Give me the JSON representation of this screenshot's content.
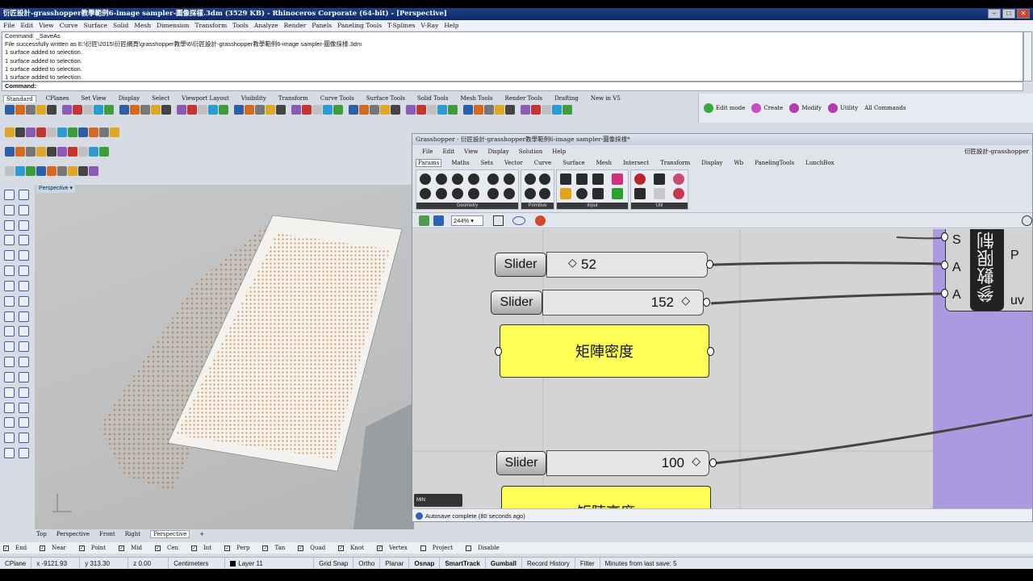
{
  "window": {
    "title": "衍匠設計-grasshopper教學範例6-image sampler-圖像採樣.3dm (3529 KB) - Rhinoceros Corporate (64-bit) - [Perspective]"
  },
  "menu": [
    "File",
    "Edit",
    "View",
    "Curve",
    "Surface",
    "Solid",
    "Mesh",
    "Dimension",
    "Transform",
    "Tools",
    "Analyze",
    "Render",
    "Panels",
    "Paneling Tools",
    "T-Splines",
    "V-Ray",
    "Help"
  ],
  "command": {
    "history": [
      "Command: _SaveAs",
      "File successfully written as E:\\衍匠\\2015\\衍匠網頁\\grasshopper教學\\6\\衍匠設計-grasshopper教學範例6-image sampler-圖像採樣.3dm",
      "1 surface added to selection.",
      "1 surface added to selection.",
      "1 surface added to selection.",
      "1 surface added to selection."
    ],
    "prompt": "Command:"
  },
  "toolbar_tabs": [
    "Standard",
    "CPlanes",
    "Set View",
    "Display",
    "Select",
    "Viewport Layout",
    "Visibility",
    "Transform",
    "Curve Tools",
    "Surface Tools",
    "Solid Tools",
    "Mesh Tools",
    "Render Tools",
    "Drafting",
    "New in V5"
  ],
  "right_panel": [
    "Edit mode",
    "Create",
    "Modify",
    "Utility",
    "All Commands"
  ],
  "viewport": {
    "title": "Perspective",
    "tabs": [
      "Top",
      "Perspective",
      "Front",
      "Right",
      "Perspective"
    ],
    "add_tab": "+"
  },
  "osnap": [
    "End",
    "Near",
    "Point",
    "Mid",
    "Cen",
    "Int",
    "Perp",
    "Tan",
    "Quad",
    "Knot",
    "Vertex",
    "Project",
    "Disable"
  ],
  "status": {
    "cplane": "CPlane",
    "x": "x -9121.93",
    "y": "y 313.30",
    "z": "z 0.00",
    "units": "Centimeters",
    "layer": "Layer 11",
    "toggles": [
      "Grid Snap",
      "Ortho",
      "Planar",
      "Osnap",
      "SmartTrack",
      "Gumball",
      "Record History",
      "Filter"
    ],
    "save_info": "Minutes from last save: 5"
  },
  "grasshopper": {
    "title": "Grasshopper - 衍匠設計-grasshopper教學範例6-image sampler-圖像採樣*",
    "title_right": "衍匠設計-grasshopper",
    "menu": [
      "File",
      "Edit",
      "View",
      "Display",
      "Solution",
      "Help"
    ],
    "tabs": [
      "Params",
      "Maths",
      "Sets",
      "Vector",
      "Curve",
      "Surface",
      "Mesh",
      "Intersect",
      "Transform",
      "Display",
      "Wb",
      "PanelingTools",
      "LunchBox"
    ],
    "groups": [
      "Geometry",
      "Primitive",
      "Input",
      "Util"
    ],
    "zoom": "244%",
    "footer": "Autosave complete (80 seconds ago)",
    "sliders": [
      {
        "label": "Slider",
        "value": "52"
      },
      {
        "label": "Slider",
        "value": "152"
      },
      {
        "label": "Slider",
        "value": "100"
      }
    ],
    "panels": [
      "矩陣密度",
      "矩陣高度"
    ],
    "component": {
      "name": "參數限制",
      "inputs": [
        "S",
        "A",
        "A"
      ],
      "outputs": [
        "P",
        "uv"
      ]
    },
    "corner_badge": "MIN"
  }
}
